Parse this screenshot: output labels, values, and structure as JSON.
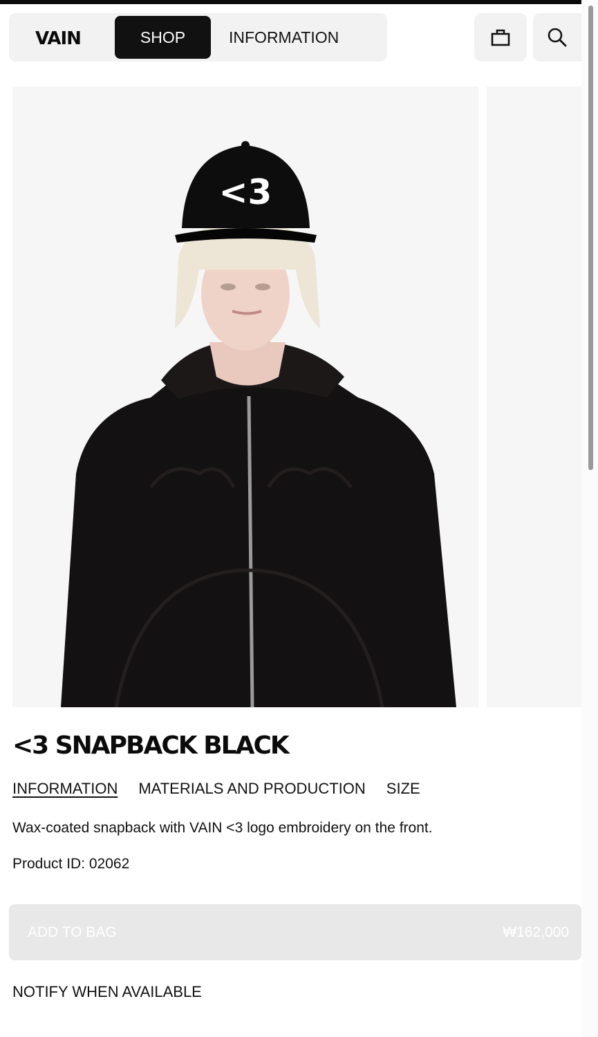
{
  "header": {
    "logo": "VAIN",
    "nav": [
      {
        "label": "SHOP",
        "active": true
      },
      {
        "label": "INFORMATION",
        "active": false
      }
    ],
    "icons": [
      "bag-icon",
      "search-icon"
    ]
  },
  "gallery": {
    "cap_text": "<3",
    "photo_count_visible": 2
  },
  "product": {
    "title": "<3 SNAPBACK BLACK",
    "tabs": [
      {
        "label": "INFORMATION",
        "active": true
      },
      {
        "label": "MATERIALS AND PRODUCTION",
        "active": false
      },
      {
        "label": "SIZE",
        "active": false
      }
    ],
    "description": "Wax-coated snapback with VAIN <3 logo embroidery on the front.",
    "product_id": "Product ID: 02062",
    "add_to_bag": {
      "label": "ADD TO BAG",
      "price": "₩162,000",
      "disabled": true
    },
    "notify": "NOTIFY WHEN AVAILABLE"
  },
  "colors": {
    "accent": "#111111",
    "nav_bg": "#f2f2f2",
    "disabled_button": "#e8e8e8",
    "photo_bg": "#f6f6f6"
  }
}
